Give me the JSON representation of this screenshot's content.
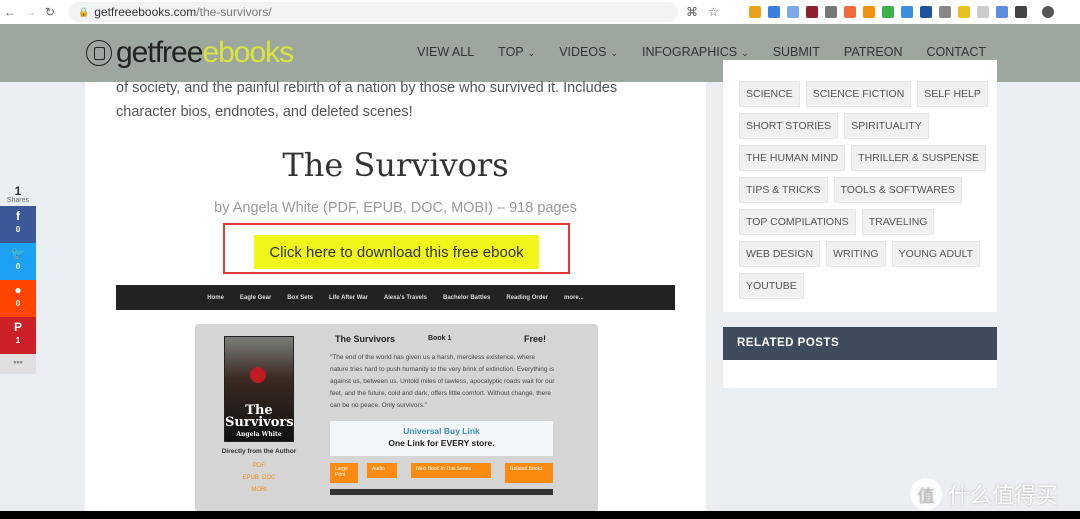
{
  "browser": {
    "url_host": "getfreeebooks.com",
    "url_path": "/the-survivors/"
  },
  "header": {
    "logo_a": "getfree",
    "logo_b": "ebooks",
    "menu": [
      {
        "label": "VIEW ALL",
        "dropdown": false
      },
      {
        "label": "TOP",
        "dropdown": true
      },
      {
        "label": "VIDEOS",
        "dropdown": true
      },
      {
        "label": "INFOGRAPHICS",
        "dropdown": true
      },
      {
        "label": "SUBMIT",
        "dropdown": false
      },
      {
        "label": "PATREON",
        "dropdown": false
      },
      {
        "label": "CONTACT",
        "dropdown": false
      }
    ]
  },
  "article": {
    "intro": "of society, and the painful rebirth of a nation by those who survived it. Includes character bios, endnotes, and deleted scenes!",
    "title": "The Survivors",
    "byline": "by Angela White (PDF, EPUB, DOC, MOBI) – 918 pages",
    "download_label": "Click here to download this free ebook"
  },
  "embed": {
    "nav": [
      "Home",
      "Eagle Gear",
      "Box Sets",
      "Life After War",
      "Alexa's Travels",
      "Bachelor Battles",
      "Reading Order",
      "more..."
    ],
    "cover_title": "The Survivors",
    "cover_author": "Angela White",
    "title": "The Survivors",
    "book": "Book 1",
    "price": "Free!",
    "quote": "\"The end of the world has given us a harsh, merciless existence, where nature tries hard to push humanity to the very brink of extinction. Everything is against us, between us. Untold miles of lawless, apocalyptic roads wait for our feet, and the future, cold and dark, offers little comfort. Without change, there can be no peace. Only survivors.\"",
    "buy_title": "Universal Buy Link",
    "buy_sub": "One Link for EVERY store.",
    "direct": "Directly from the Author",
    "formats": [
      "PDF",
      "EPUB",
      "DOC",
      "MOBI"
    ],
    "buttons": [
      "Large Print",
      "Audio",
      "Next Book In This Series",
      "Related Books"
    ]
  },
  "share": {
    "count": "1",
    "label": "Shares",
    "items": [
      {
        "icon": "facebook-icon",
        "glyph": "f",
        "count": "0",
        "color": "#3b5998"
      },
      {
        "icon": "twitter-icon",
        "glyph": "🐦",
        "count": "0",
        "color": "#1da1f2"
      },
      {
        "icon": "reddit-icon",
        "glyph": "●",
        "count": "0",
        "color": "#ff4500"
      },
      {
        "icon": "pinterest-icon",
        "glyph": "P",
        "count": "1",
        "color": "#cb2027"
      }
    ],
    "more": "•••"
  },
  "sidebar": {
    "tags": [
      "SCIENCE",
      "SCIENCE FICTION",
      "SELF HELP",
      "SHORT STORIES",
      "SPIRITUALITY",
      "THE HUMAN MIND",
      "THRILLER & SUSPENSE",
      "TIPS & TRICKS",
      "TOOLS & SOFTWARES",
      "TOP COMPILATIONS",
      "TRAVELING",
      "WEB DESIGN",
      "WRITING",
      "YOUNG ADULT",
      "YOUTUBE"
    ],
    "related_title": "RELATED POSTS"
  },
  "watermark": {
    "badge": "值",
    "text": "什么值得买"
  }
}
